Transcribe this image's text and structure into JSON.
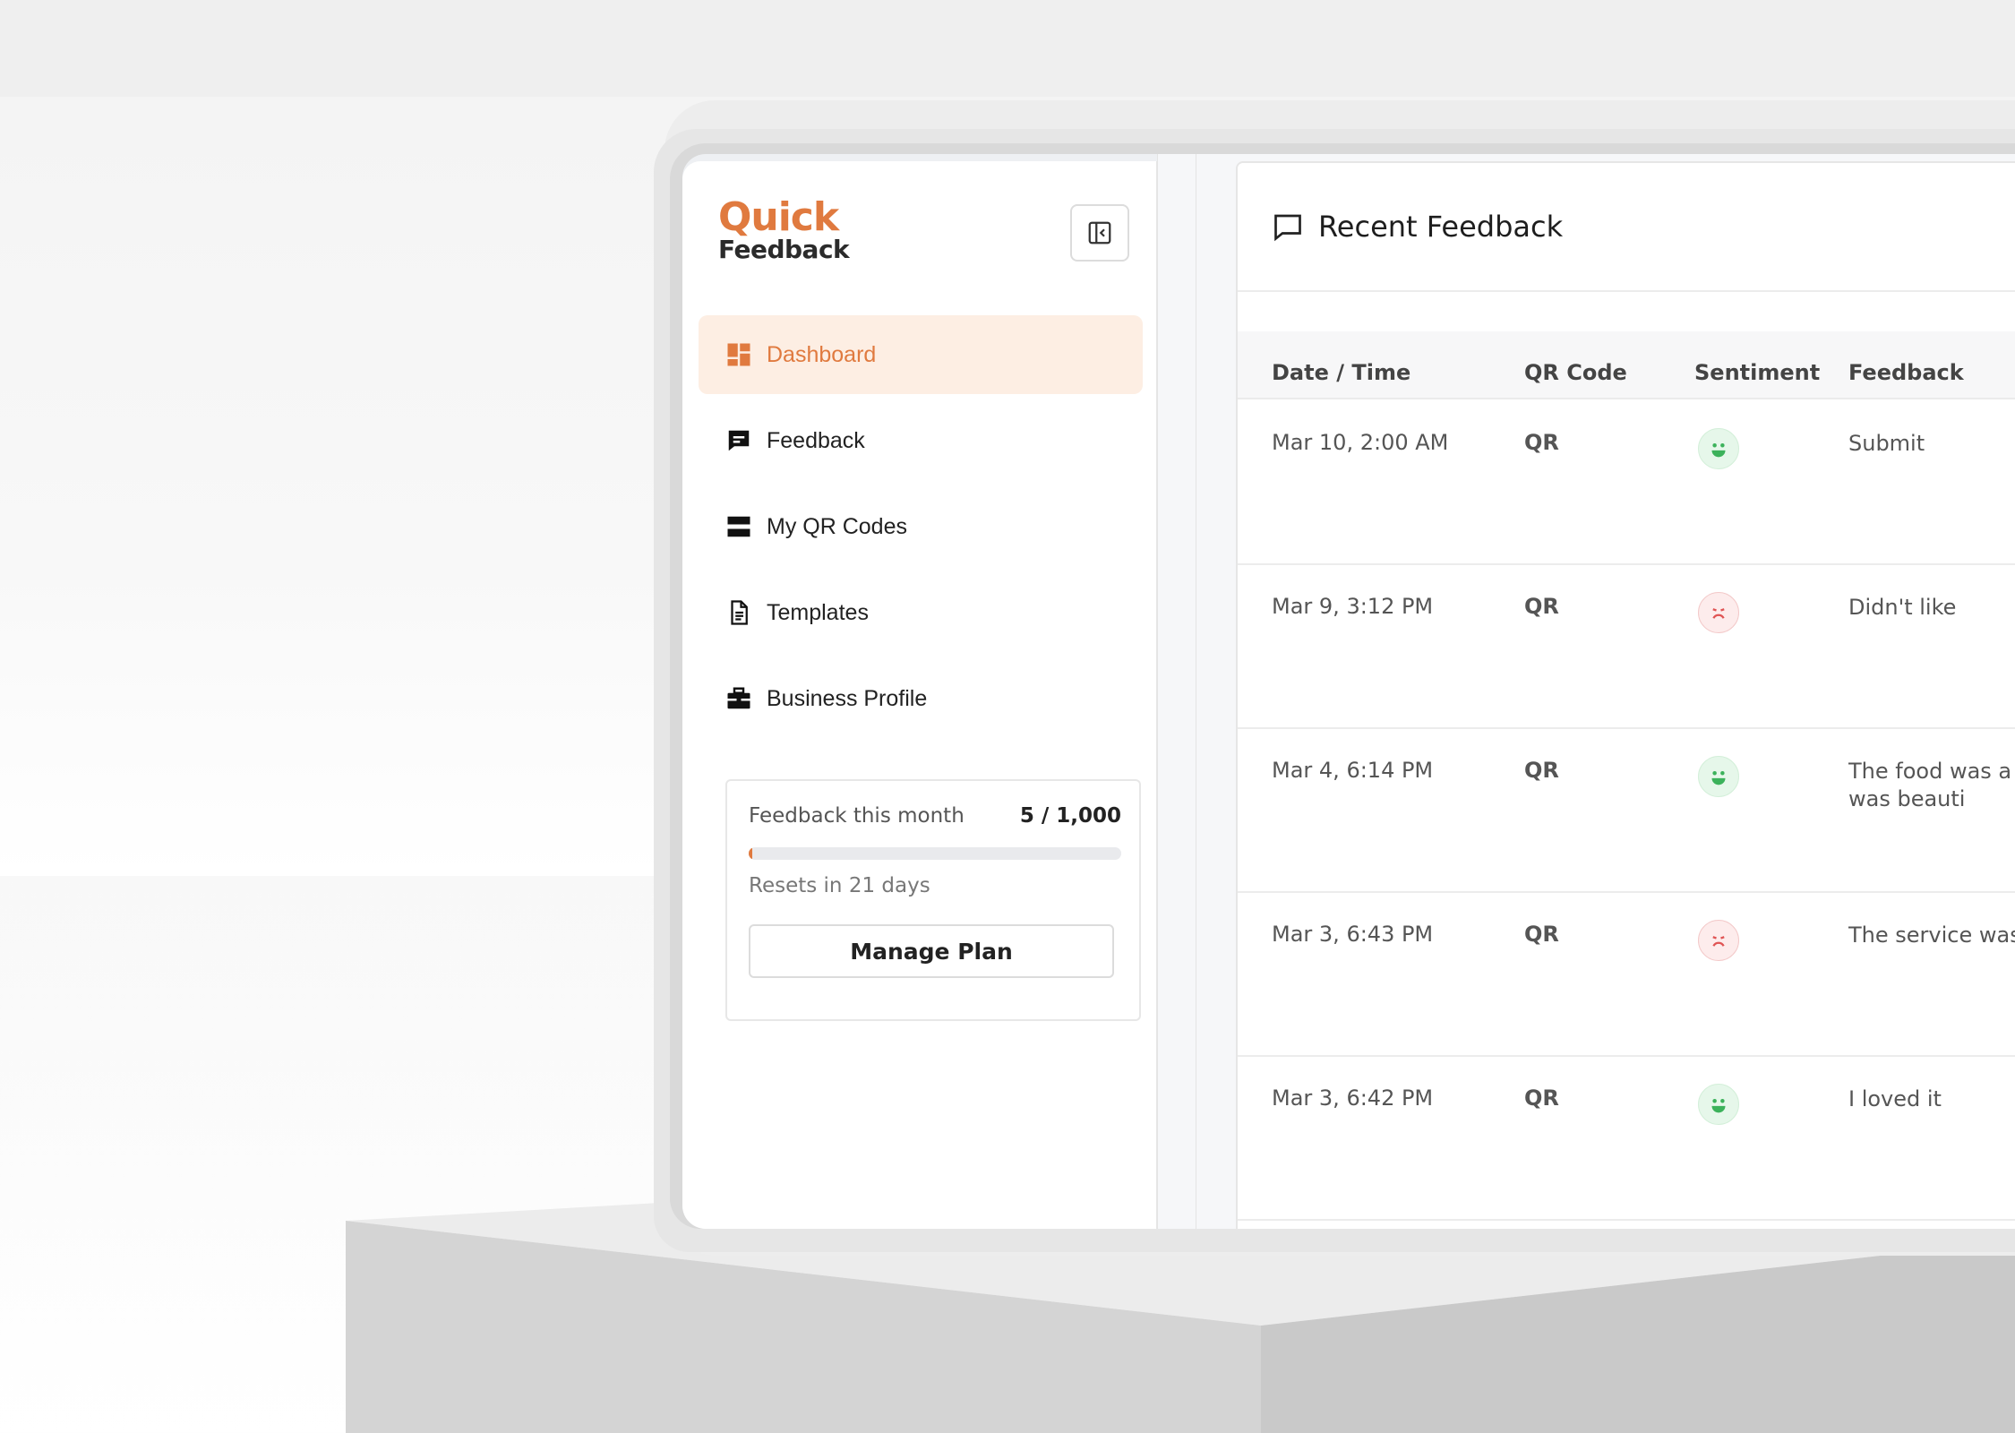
{
  "brand": {
    "logo_top": "Quick",
    "logo_bottom": "Feedback",
    "accent": "#e07a3f"
  },
  "sidebar": {
    "items": [
      {
        "label": "Dashboard",
        "icon": "dashboard-icon",
        "active": true
      },
      {
        "label": "Feedback",
        "icon": "chat-bubble-icon",
        "active": false
      },
      {
        "label": "My QR Codes",
        "icon": "qr-code-icon",
        "active": false
      },
      {
        "label": "Templates",
        "icon": "document-icon",
        "active": false
      },
      {
        "label": "Business Profile",
        "icon": "briefcase-icon",
        "active": false
      }
    ],
    "usage": {
      "label": "Feedback this month",
      "count": "5 / 1,000",
      "fraction": 0.005,
      "reset_text": "Resets in 21 days",
      "button_label": "Manage Plan"
    }
  },
  "main": {
    "title": "Recent Feedback",
    "columns": [
      "Date / Time",
      "QR Code",
      "Sentiment",
      "Feedback"
    ],
    "rows": [
      {
        "date": "Mar 10, 2:00 AM",
        "qr": "QR",
        "sentiment": "positive",
        "feedback": "Submit"
      },
      {
        "date": "Mar 9, 3:12 PM",
        "qr": "QR",
        "sentiment": "negative",
        "feedback": "Didn't like"
      },
      {
        "date": "Mar 4, 6:14 PM",
        "qr": "QR",
        "sentiment": "positive",
        "feedback": "The food was a dish was beauti"
      },
      {
        "date": "Mar 3, 6:43 PM",
        "qr": "QR",
        "sentiment": "negative",
        "feedback": "The service was"
      },
      {
        "date": "Mar 3, 6:42 PM",
        "qr": "QR",
        "sentiment": "positive",
        "feedback": "I loved it"
      }
    ]
  }
}
